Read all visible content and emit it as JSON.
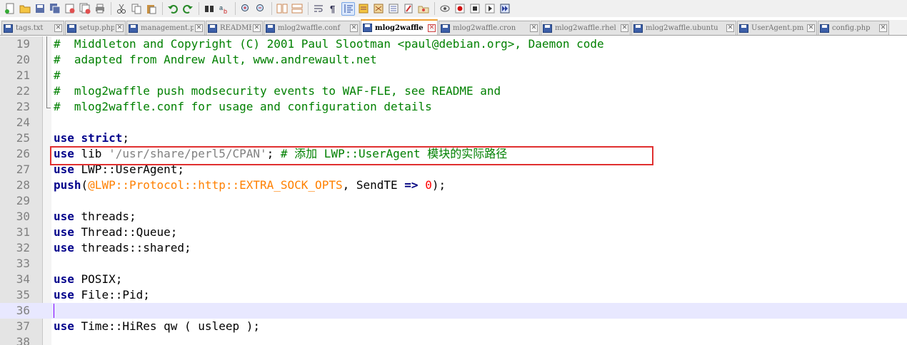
{
  "toolbar": {
    "icons": [
      "new-file-icon",
      "open-file-icon",
      "save-icon",
      "save-all-icon",
      "close-icon",
      "close-all-icon",
      "print-icon",
      "cut-icon",
      "copy-icon",
      "paste-icon",
      "undo-icon",
      "redo-icon",
      "find-icon",
      "replace-icon",
      "zoom-in-icon",
      "zoom-out-icon",
      "sync-vertical-icon",
      "sync-horizontal-icon",
      "word-wrap-icon",
      "show-all-chars-icon",
      "indent-guide-icon",
      "udl-icon",
      "doc-map-icon",
      "function-list-icon",
      "folder-workspace-icon",
      "monitor-icon",
      "record-macro-icon",
      "stop-record-icon",
      "play-macro-icon",
      "run-macro-multiple-icon",
      "save-macro-icon"
    ]
  },
  "tabs": [
    {
      "label": "tags.txt",
      "active": false
    },
    {
      "label": "setup.php",
      "active": false
    },
    {
      "label": "management.php",
      "active": false
    },
    {
      "label": "README",
      "active": false
    },
    {
      "label": "mlog2waffle.conf",
      "active": false
    },
    {
      "label": "mlog2waffle",
      "active": true
    },
    {
      "label": "mlog2waffle.cron",
      "active": false
    },
    {
      "label": "mlog2waffle.rhel",
      "active": false
    },
    {
      "label": "mlog2waffle.ubuntu",
      "active": false
    },
    {
      "label": "UserAgent.pm",
      "active": false
    },
    {
      "label": "config.php",
      "active": false
    }
  ],
  "editor": {
    "current_line": "36",
    "lines": [
      {
        "num": "19",
        "segments": [
          {
            "t": "#  Middleton and Copyright (C) 2001 Paul Slootman <paul@debian.org>, Daemon code",
            "c": "comment"
          }
        ]
      },
      {
        "num": "20",
        "segments": [
          {
            "t": "#  adapted from Andrew Ault, www.andrewault.net",
            "c": "comment"
          }
        ]
      },
      {
        "num": "21",
        "segments": [
          {
            "t": "#",
            "c": "comment"
          }
        ]
      },
      {
        "num": "22",
        "segments": [
          {
            "t": "#  mlog2waffle push modsecurity events to WAF-FLE, see README and",
            "c": "comment"
          }
        ]
      },
      {
        "num": "23",
        "segments": [
          {
            "t": "#  mlog2waffle.conf for usage and configuration details",
            "c": "comment"
          }
        ]
      },
      {
        "num": "24",
        "segments": []
      },
      {
        "num": "25",
        "segments": [
          {
            "t": "use",
            "c": "kw"
          },
          {
            "t": " ",
            "c": "plain"
          },
          {
            "t": "strict",
            "c": "kw"
          },
          {
            "t": ";",
            "c": "plain"
          }
        ]
      },
      {
        "num": "26",
        "segments": [
          {
            "t": "use",
            "c": "kw"
          },
          {
            "t": " lib ",
            "c": "plain"
          },
          {
            "t": "'/usr/share/perl5/CPAN'",
            "c": "str"
          },
          {
            "t": "; ",
            "c": "plain"
          },
          {
            "t": "# 添加 LWP::UserAgent 模块的实际路径",
            "c": "comment"
          }
        ]
      },
      {
        "num": "27",
        "segments": [
          {
            "t": "use",
            "c": "kw"
          },
          {
            "t": " LWP::UserAgent;",
            "c": "plain"
          }
        ]
      },
      {
        "num": "28",
        "segments": [
          {
            "t": "push",
            "c": "kw"
          },
          {
            "t": "(",
            "c": "plain"
          },
          {
            "t": "@LWP::Protocol::http::EXTRA_SOCK_OPTS",
            "c": "var"
          },
          {
            "t": ", SendTE ",
            "c": "plain"
          },
          {
            "t": "=>",
            "c": "op"
          },
          {
            "t": " ",
            "c": "plain"
          },
          {
            "t": "0",
            "c": "num"
          },
          {
            "t": ");",
            "c": "plain"
          }
        ]
      },
      {
        "num": "29",
        "segments": []
      },
      {
        "num": "30",
        "segments": [
          {
            "t": "use",
            "c": "kw"
          },
          {
            "t": " threads;",
            "c": "plain"
          }
        ]
      },
      {
        "num": "31",
        "segments": [
          {
            "t": "use",
            "c": "kw"
          },
          {
            "t": " Thread::Queue;",
            "c": "plain"
          }
        ]
      },
      {
        "num": "32",
        "segments": [
          {
            "t": "use",
            "c": "kw"
          },
          {
            "t": " threads::shared;",
            "c": "plain"
          }
        ]
      },
      {
        "num": "33",
        "segments": []
      },
      {
        "num": "34",
        "segments": [
          {
            "t": "use",
            "c": "kw"
          },
          {
            "t": " POSIX;",
            "c": "plain"
          }
        ]
      },
      {
        "num": "35",
        "segments": [
          {
            "t": "use",
            "c": "kw"
          },
          {
            "t": " File::Pid;",
            "c": "plain"
          }
        ]
      },
      {
        "num": "36",
        "segments": []
      },
      {
        "num": "37",
        "segments": [
          {
            "t": "use",
            "c": "kw"
          },
          {
            "t": " Time::HiRes qw ( usleep );",
            "c": "plain"
          }
        ]
      },
      {
        "num": "38",
        "segments": []
      }
    ]
  }
}
